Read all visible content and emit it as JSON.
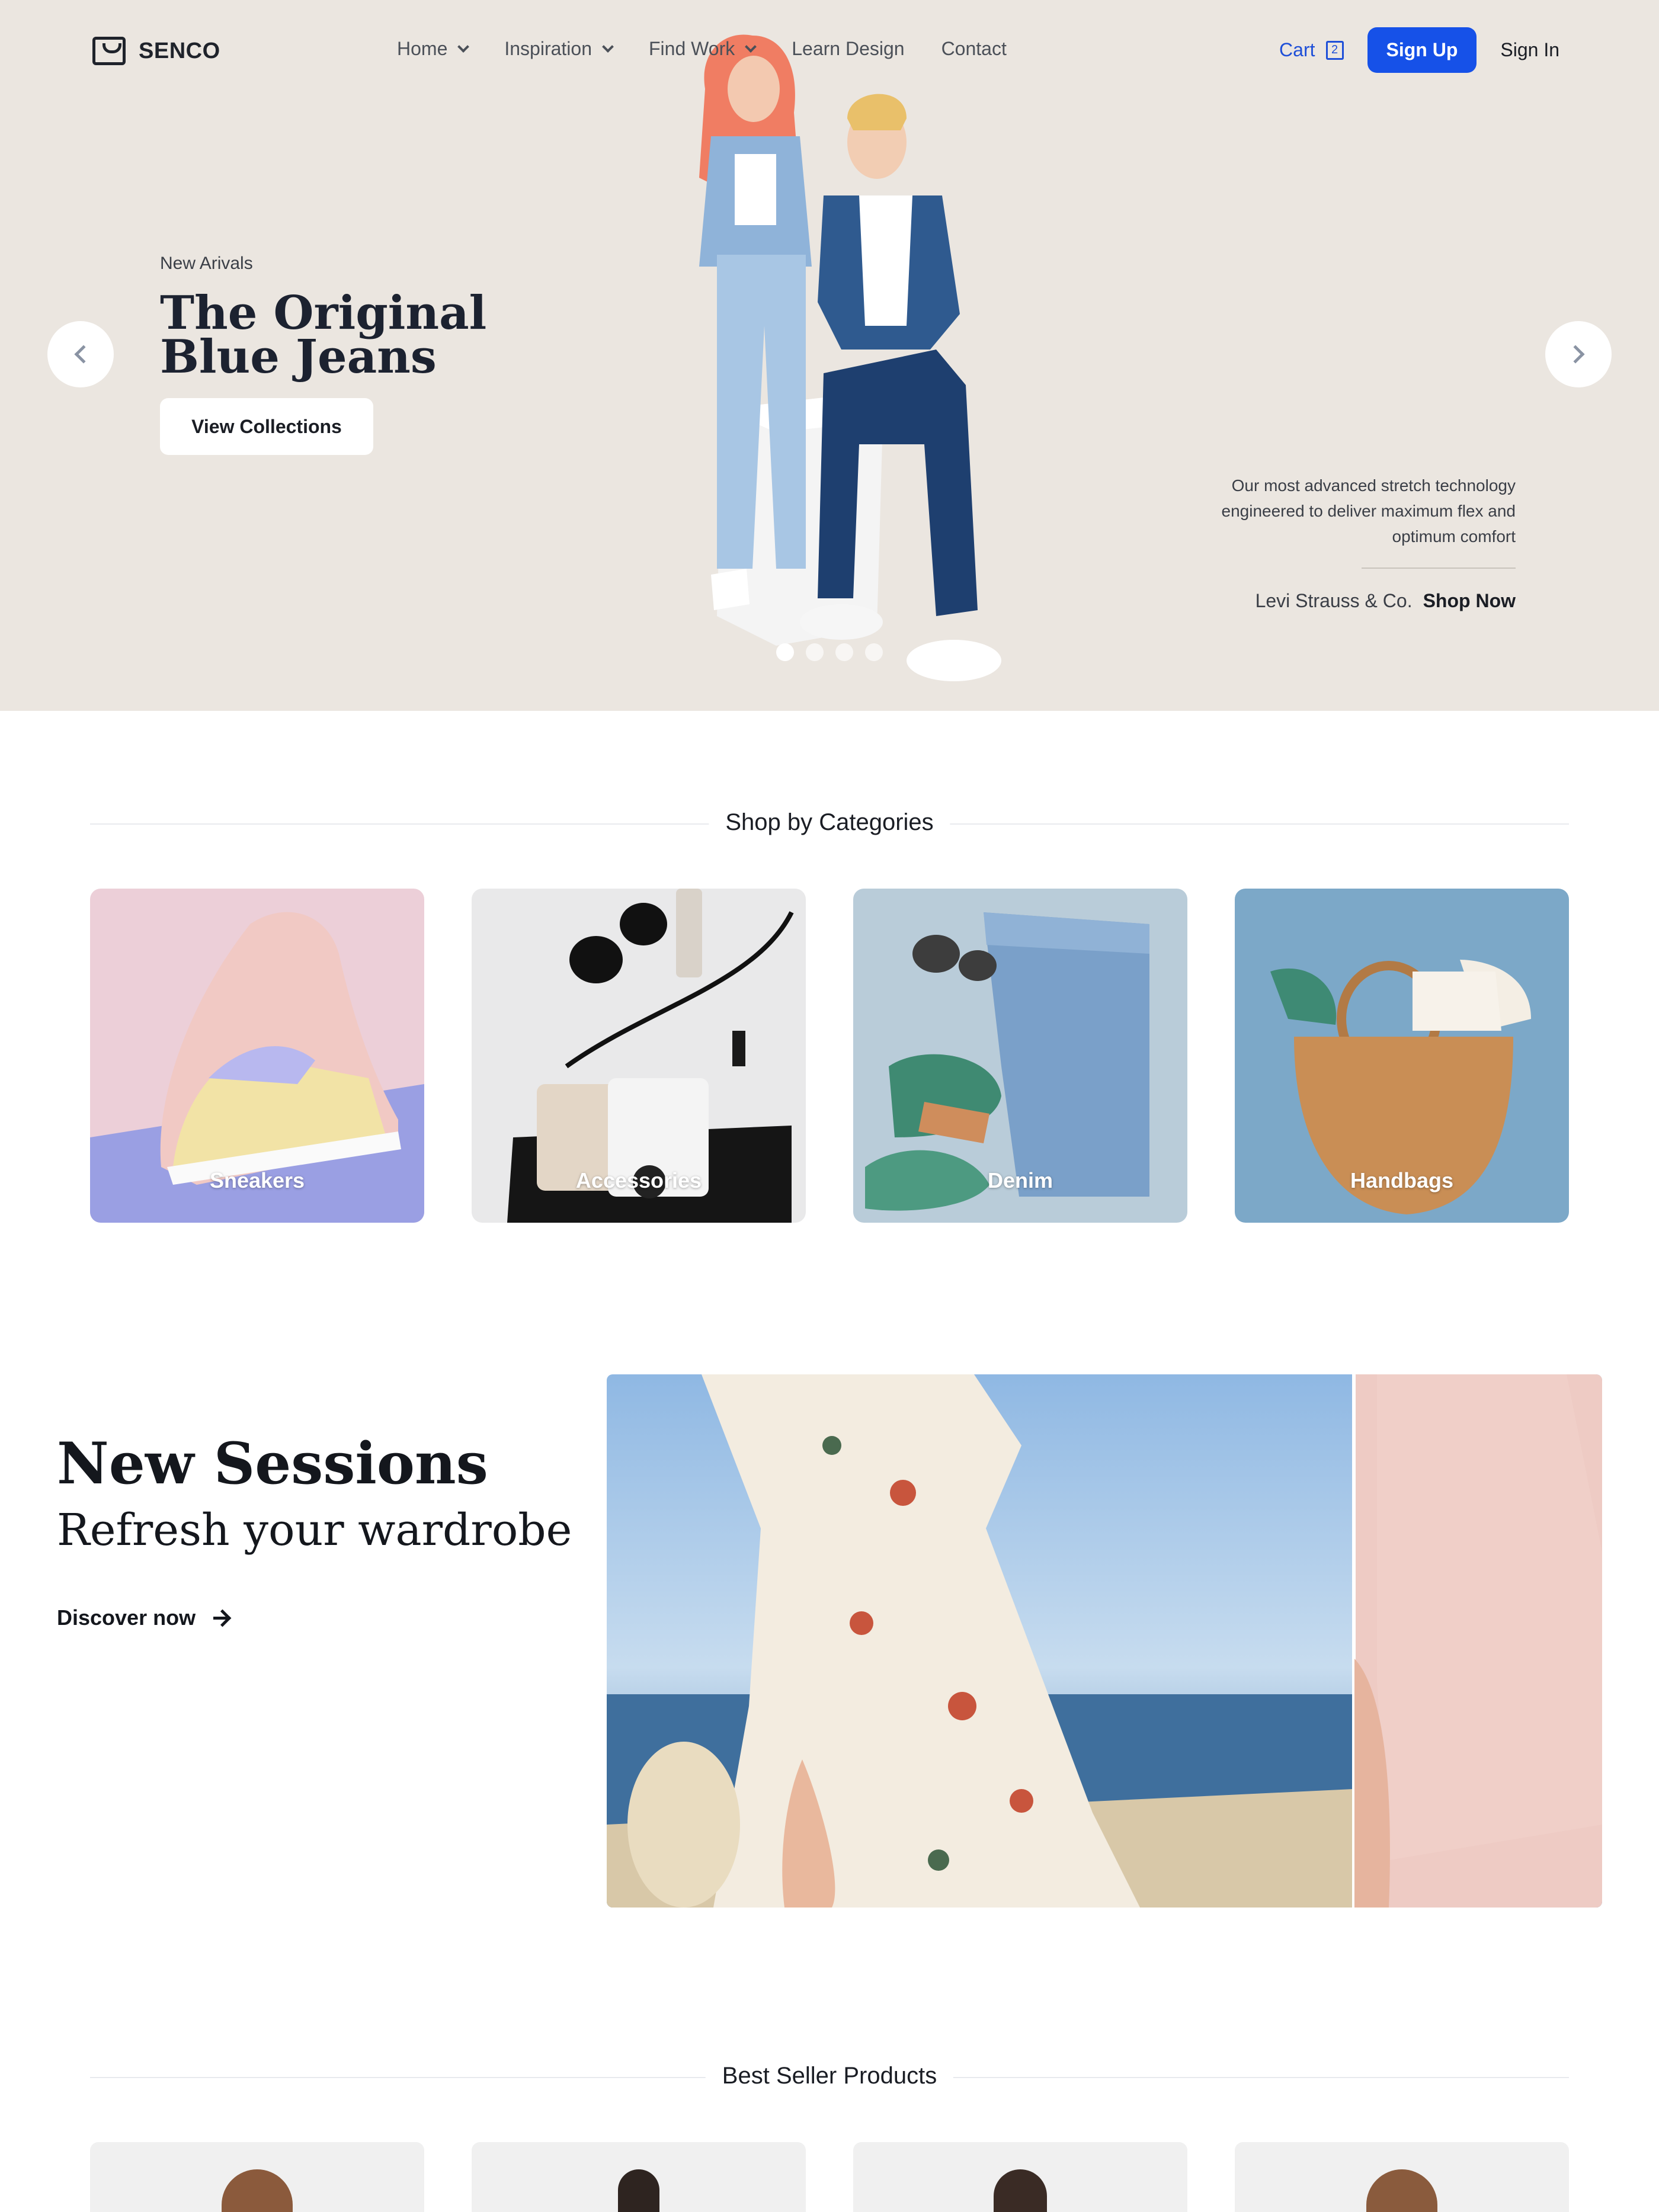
{
  "nav": {
    "brand": "SENCO",
    "menu": [
      {
        "label": "Home",
        "has_dropdown": true
      },
      {
        "label": "Inspiration",
        "has_dropdown": true
      },
      {
        "label": "Find Work",
        "has_dropdown": true
      },
      {
        "label": "Learn Design",
        "has_dropdown": false
      },
      {
        "label": "Contact",
        "has_dropdown": false
      }
    ],
    "cart_label": "Cart",
    "cart_count": "2",
    "signup_label": "Sign Up",
    "signin_label": "Sign In"
  },
  "hero": {
    "kicker": "New Arivals",
    "title": "The Original Blue Jeans",
    "cta_label": "View Collections",
    "description": "Our most advanced stretch technology engineered to deliver maximum flex and optimum comfort",
    "brand": "Levi Strauss & Co.",
    "shop_label": "Shop Now",
    "slides": 4,
    "active_slide": 1
  },
  "categories": {
    "title": "Shop by Categories",
    "items": [
      {
        "label": "Sneakers",
        "icon": "sneaker-photo"
      },
      {
        "label": "Accessories",
        "icon": "accessories-photo"
      },
      {
        "label": "Denim",
        "icon": "denim-photo"
      },
      {
        "label": "Handbags",
        "icon": "handbag-photo"
      }
    ]
  },
  "new_sessions": {
    "title": "New Sessions",
    "subtitle": "Refresh your wardrobe",
    "link_label": "Discover now"
  },
  "best_sellers": {
    "title": "Best Seller Products"
  },
  "colors": {
    "hero_bg": "#ebe6e0",
    "accent": "#1651e8",
    "text": "#1a1d24"
  }
}
